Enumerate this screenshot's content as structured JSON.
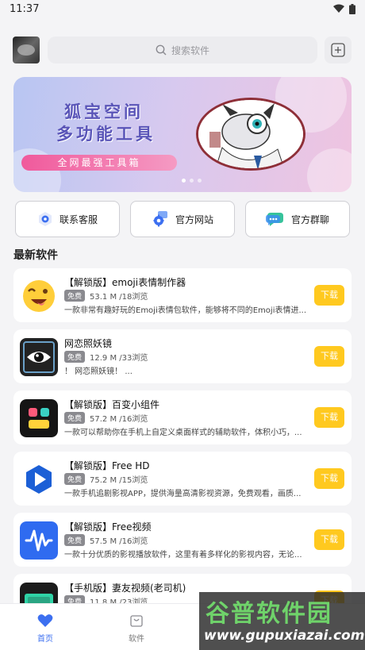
{
  "status": {
    "time": "11:37"
  },
  "search": {
    "placeholder": "搜索软件"
  },
  "banner": {
    "title_line1": "狐宝空间",
    "title_line2": "多功能工具",
    "pill": "全网最强工具箱"
  },
  "quick_actions": [
    {
      "label": "联系客服",
      "icon": "support-icon"
    },
    {
      "label": "官方网站",
      "icon": "website-gear-icon"
    },
    {
      "label": "官方群聊",
      "icon": "chat-icon"
    }
  ],
  "section_title": "最新软件",
  "apps": [
    {
      "title": "【解锁版】emoji表情制作器",
      "badge": "免费",
      "stats": "53.1 M /18浏览",
      "desc": "一款非常有趣好玩的Emoji表情包软件，能够将不同的Emoji表情进...",
      "button": "下载",
      "icon": "emoji-face-icon"
    },
    {
      "title": "网恋照妖镜",
      "badge": "免费",
      "stats": "12.9 M /33浏览",
      "desc": "！ 网恋照妖镜！ ...",
      "button": "下载",
      "icon": "eye-icon"
    },
    {
      "title": "【解锁版】百变小组件",
      "badge": "免费",
      "stats": "57.2 M /16浏览",
      "desc": "一款可以帮助你在手机上自定义桌面样式的辅助软件，体积小巧，...",
      "button": "下载",
      "icon": "widget-blocks-icon"
    },
    {
      "title": "【解锁版】Free HD",
      "badge": "免费",
      "stats": "75.2 M /15浏览",
      "desc": "一款手机追剧影视APP，提供海量高清影视资源，免费观看，画质...",
      "button": "下载",
      "icon": "play-icon"
    },
    {
      "title": "【解锁版】Free视频",
      "badge": "免费",
      "stats": "57.5 M /16浏览",
      "desc": "一款十分优质的影视播放软件，这里有着多样化的影视内容，无论...",
      "button": "下载",
      "icon": "waveform-icon"
    },
    {
      "title": "【手机版】妻友视频(老司机)",
      "badge": "免费",
      "stats": "11.8 M /23浏览",
      "desc": "",
      "button": "下载",
      "icon": "qiyou-logo-icon"
    }
  ],
  "tabs": [
    {
      "label": "首页"
    },
    {
      "label": "软件"
    }
  ],
  "watermark": {
    "line1": "谷普软件园",
    "line2": "www.gupuxiazai.com"
  },
  "colors": {
    "accent": "#3c6ff0",
    "download": "#ffc91f"
  }
}
